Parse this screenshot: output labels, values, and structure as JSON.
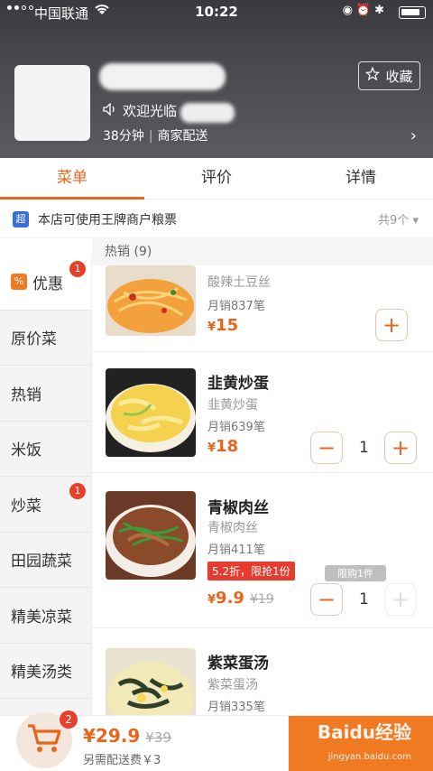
{
  "status_bar": {
    "carrier": "中国联通",
    "time": "10:22"
  },
  "shop": {
    "welcome_text": "欢迎光临",
    "delivery_time": "38分钟",
    "delivery_type": "商家配送",
    "favorite_label": "收藏"
  },
  "tabs": [
    {
      "label": "菜单",
      "active": true
    },
    {
      "label": "评价",
      "active": false
    },
    {
      "label": "详情",
      "active": false
    }
  ],
  "notice": {
    "badge": "超",
    "text": "本店可使用王牌商户粮票",
    "count": "共9个"
  },
  "categories": [
    {
      "label": "优惠",
      "badge": "1",
      "icon": "percent-icon"
    },
    {
      "label": "原价菜"
    },
    {
      "label": "热销"
    },
    {
      "label": "米饭"
    },
    {
      "label": "炒菜",
      "badge": "1"
    },
    {
      "label": "田园蔬菜"
    },
    {
      "label": "精美凉菜"
    },
    {
      "label": "精美汤类"
    }
  ],
  "section_title": "热销 (9)",
  "items": [
    {
      "name": "",
      "sub": "酸辣土豆丝",
      "sales": "月销837笔",
      "price_symbol": "¥",
      "price": "15"
    },
    {
      "name": "韭黄炒蛋",
      "sub": "韭黄炒蛋",
      "sales": "月销639笔",
      "price_symbol": "¥",
      "price": "18",
      "qty": "1"
    },
    {
      "name": "青椒肉丝",
      "sub": "青椒肉丝",
      "sales": "月销411笔",
      "discount": "5.2折，限抢1份",
      "price_symbol": "¥",
      "price": "9.9",
      "orig_price": "¥19",
      "qty": "1",
      "limit": "限购1件"
    },
    {
      "name": "紫菜蛋汤",
      "sub": "紫菜蛋汤",
      "sales": "月销335笔"
    }
  ],
  "cart": {
    "count": "2",
    "total_symbol": "¥",
    "total": "29.9",
    "orig_total": "¥39",
    "delivery_fee": "另需配送费￥3"
  },
  "watermark": {
    "text": "Baidu经验",
    "url": "jingyan.baidu.com"
  },
  "colors": {
    "accent": "#e8651c",
    "badge": "#e6402a",
    "header_bg": "#4b4a4f"
  }
}
